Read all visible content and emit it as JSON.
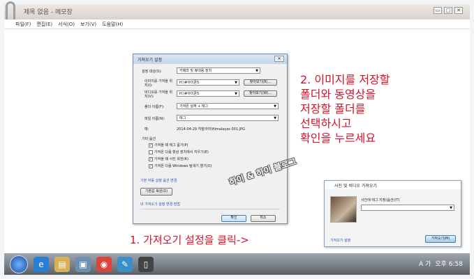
{
  "window": {
    "title": "제목 없음 - 메모장",
    "menu": [
      "파일(F)",
      "편집(E)",
      "서식(O)",
      "보기(V)",
      "도움말(H)"
    ],
    "buttons": [
      "▭",
      "□",
      "✕"
    ]
  },
  "import_dialog": {
    "title": "가져오기 설정",
    "close": "✕",
    "settings_for_label": "설정 대상(S):",
    "settings_for_value": "카메라 및 휴대용 장치",
    "photos_folder_label": "이미지를 가져올 위치(I):",
    "photos_folder_value": "H:\\#아이폰5",
    "videos_folder_label": "비디오를 가져올 위치(V):",
    "videos_folder_value": "H:\\#아이폰5",
    "browse1": "찾아보기(R)...",
    "browse2": "찾아보기(W)...",
    "folder_name_label": "폴더 이름(F):",
    "folder_name_value": "가져온 날짜 + 태그",
    "file_name_label": "파일 이름(N):",
    "file_name_value": "태그",
    "example_label": "예:",
    "example_value": "2014-04-29 히말라야\\Himalayas 001.JPG",
    "other_options": "기타 옵션",
    "options": [
      {
        "label": "가져올 때 태그 묻기(P)",
        "checked": true
      },
      {
        "label": "가져온 다음 항상 장치에서 지우기(E)",
        "checked": false
      },
      {
        "label": "가져올 때 사진 회전(R)",
        "checked": true
      },
      {
        "label": "가져온 다음 Windows 탐색기 열기(O)",
        "checked": true
      }
    ],
    "autoplay_link": "기본 자동 실행 옵션 변경",
    "restore_button": "기본값 복원(D)",
    "how_link": "내 가져오기 설정 변경 방법",
    "ok": "확인",
    "cancel": "취소"
  },
  "photo_dialog": {
    "title": "사진 및 비디오 가져오기",
    "tag_label": "사진에 태그 지정(옵션)(T)",
    "settings_link": "가져오기 설정",
    "import_button": "가져오기(M)"
  },
  "annotations": {
    "step2": [
      "2. 이미지를 저장할",
      "폴더와 동영상을",
      "저장할 폴더를",
      "선택하시고",
      "확인을 누르세요"
    ],
    "step1": "1. 가져오기 설정을 클릭->",
    "stamp": "하이 & 하이 블로그"
  },
  "taskbar": {
    "clock": "오후 6:58",
    "lang": "A 가"
  },
  "colors": {
    "annotation": "#d4132a",
    "link": "#2a55b5"
  }
}
